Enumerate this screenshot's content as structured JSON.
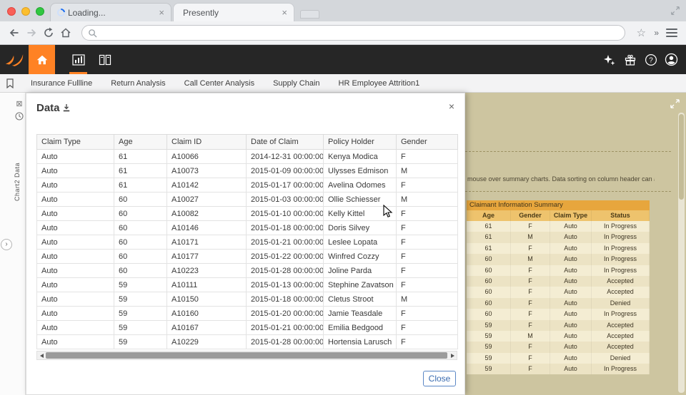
{
  "browser": {
    "tabs": [
      {
        "title": "Loading..."
      },
      {
        "title": "Presently"
      }
    ],
    "close_glyph": "×",
    "address_value": "",
    "overflow_glyph": "»",
    "star_glyph": "☆"
  },
  "app_nav": {
    "items": [
      "Insurance Fullline",
      "Return Analysis",
      "Call Center Analysis",
      "Supply Chain",
      "HR Employee Attrition1"
    ]
  },
  "left_rail": {
    "pane_label": "Chart2 Data",
    "remove_glyph": "⊠",
    "expander_glyph": "›"
  },
  "data_modal": {
    "title": "Data",
    "close_icon": "×",
    "close_button": "Close",
    "table": {
      "columns": [
        "Claim Type",
        "Age",
        "Claim ID",
        "Date of Claim",
        "Policy Holder",
        "Gender"
      ],
      "rows": [
        [
          "Auto",
          "61",
          "A10066",
          "2014-12-31 00:00:00",
          "Kenya Modica",
          "F"
        ],
        [
          "Auto",
          "61",
          "A10073",
          "2015-01-09 00:00:00",
          "Ulysses Edmison",
          "M"
        ],
        [
          "Auto",
          "61",
          "A10142",
          "2015-01-17 00:00:00",
          "Avelina Odomes",
          "F"
        ],
        [
          "Auto",
          "60",
          "A10027",
          "2015-01-03 00:00:00",
          "Ollie Schiesser",
          "M"
        ],
        [
          "Auto",
          "60",
          "A10082",
          "2015-01-10 00:00:00",
          "Kelly Kittel",
          "F"
        ],
        [
          "Auto",
          "60",
          "A10146",
          "2015-01-18 00:00:00",
          "Doris Silvey",
          "F"
        ],
        [
          "Auto",
          "60",
          "A10171",
          "2015-01-21 00:00:00",
          "Leslee Lopata",
          "F"
        ],
        [
          "Auto",
          "60",
          "A10177",
          "2015-01-22 00:00:00",
          "Winfred Cozzy",
          "F"
        ],
        [
          "Auto",
          "60",
          "A10223",
          "2015-01-28 00:00:00",
          "Joline Parda",
          "F"
        ],
        [
          "Auto",
          "59",
          "A10111",
          "2015-01-13 00:00:00",
          "Stephine Zavatson",
          "F"
        ],
        [
          "Auto",
          "59",
          "A10150",
          "2015-01-18 00:00:00",
          "Cletus Stroot",
          "M"
        ],
        [
          "Auto",
          "59",
          "A10160",
          "2015-01-20 00:00:00",
          "Jamie Teasdale",
          "F"
        ],
        [
          "Auto",
          "59",
          "A10167",
          "2015-01-21 00:00:00",
          "Emilia Bedgood",
          "F"
        ],
        [
          "Auto",
          "59",
          "A10229",
          "2015-01-28 00:00:00",
          "Hortensia Larusch",
          "F"
        ]
      ]
    }
  },
  "right_panel": {
    "hint_text": "mouse over summary charts. Data sorting on column header can also be",
    "summary_table": {
      "title": "Claimant Information Summary",
      "columns": [
        "Age",
        "Gender",
        "Claim Type",
        "Status"
      ],
      "rows": [
        [
          "61",
          "F",
          "Auto",
          "In Progress"
        ],
        [
          "61",
          "M",
          "Auto",
          "In Progress"
        ],
        [
          "61",
          "F",
          "Auto",
          "In Progress"
        ],
        [
          "60",
          "M",
          "Auto",
          "In Progress"
        ],
        [
          "60",
          "F",
          "Auto",
          "In Progress"
        ],
        [
          "60",
          "F",
          "Auto",
          "Accepted"
        ],
        [
          "60",
          "F",
          "Auto",
          "Accepted"
        ],
        [
          "60",
          "F",
          "Auto",
          "Denied"
        ],
        [
          "60",
          "F",
          "Auto",
          "In Progress"
        ],
        [
          "59",
          "F",
          "Auto",
          "Accepted"
        ],
        [
          "59",
          "M",
          "Auto",
          "Accepted"
        ],
        [
          "59",
          "F",
          "Auto",
          "Accepted"
        ],
        [
          "59",
          "F",
          "Auto",
          "Denied"
        ],
        [
          "59",
          "F",
          "Auto",
          "In Progress"
        ]
      ]
    }
  },
  "colors": {
    "accent_orange": "#ff8224",
    "header_dark": "#262626",
    "panel_tan": "#cdc5a0",
    "summary_title_bg": "#e7a63d",
    "summary_header_bg": "#eec36d",
    "close_button_blue": "#3a6cb0"
  }
}
